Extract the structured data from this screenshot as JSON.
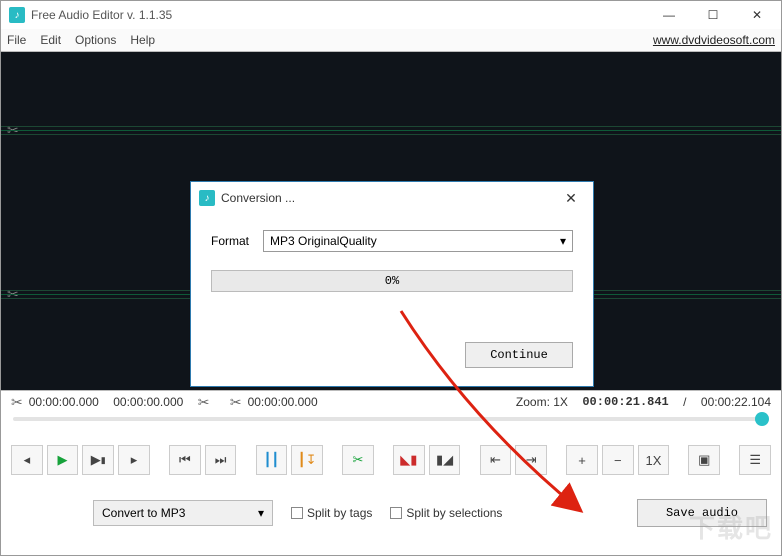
{
  "window": {
    "title": "Free Audio Editor v. 1.1.35",
    "url": "www.dvdvideosoft.com"
  },
  "menu": {
    "file": "File",
    "edit": "Edit",
    "options": "Options",
    "help": "Help"
  },
  "selection": {
    "start": "00:00:00.000",
    "end": "00:00:00.000",
    "cursor": "00:00:00.000",
    "zoom_label": "Zoom: 1X",
    "current": "00:00:21.841",
    "total": "00:00:22.104",
    "sep": "/"
  },
  "toolbar": {
    "zoom_btn": "1X"
  },
  "bottom": {
    "convert_label": "Convert to MP3",
    "split_tags": "Split by tags",
    "split_sel": "Split by selections",
    "save": "Save audio"
  },
  "dialog": {
    "title": "Conversion ...",
    "format_label": "Format",
    "format_value": "MP3 OriginalQuality",
    "progress": "0%",
    "continue": "Continue"
  },
  "watermark": "下载吧"
}
